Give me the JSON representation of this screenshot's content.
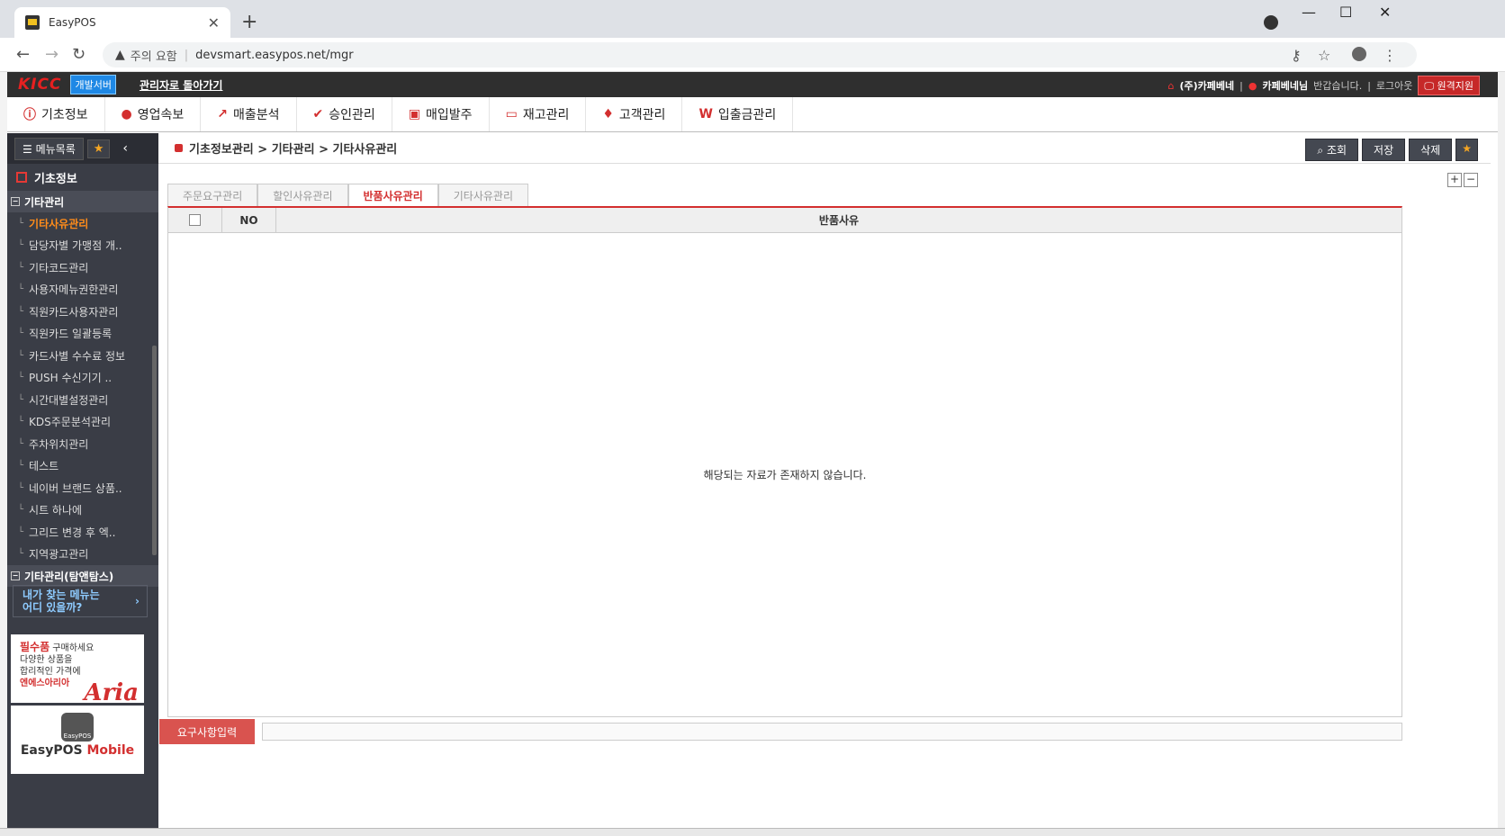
{
  "browser": {
    "tab_title": "EasyPOS",
    "security_label": "주의 요함",
    "url": "devsmart.easypos.net/mgr"
  },
  "header": {
    "logo": "KICC",
    "dev_badge": "개발서버",
    "back_link": "관리자로 돌아가기",
    "store": "(주)카페베네",
    "user": "카페베네님",
    "greeting": "반갑습니다.",
    "logout": "로그아웃",
    "remote": "원격지원"
  },
  "nav": [
    {
      "label": "기초정보",
      "icon": "ⓘ"
    },
    {
      "label": "영업속보",
      "icon": "●"
    },
    {
      "label": "매출분석",
      "icon": "↗"
    },
    {
      "label": "승인관리",
      "icon": "✔"
    },
    {
      "label": "매입발주",
      "icon": "▣"
    },
    {
      "label": "재고관리",
      "icon": "▭"
    },
    {
      "label": "고객관리",
      "icon": "♦"
    },
    {
      "label": "입출금관리",
      "icon": "W"
    }
  ],
  "sidebar": {
    "menu_button": "메뉴목록",
    "section": "기초정보",
    "group1": "기타관리",
    "items": [
      {
        "label": "기타사유관리",
        "active": true
      },
      {
        "label": "담당자별 가맹점 개.."
      },
      {
        "label": "기타코드관리"
      },
      {
        "label": "사용자메뉴권한관리"
      },
      {
        "label": "직원카드사용자관리"
      },
      {
        "label": "직원카드 일괄등록"
      },
      {
        "label": "카드사별 수수료 정보"
      },
      {
        "label": "PUSH 수신기기 .."
      },
      {
        "label": "시간대별설정관리"
      },
      {
        "label": "KDS주문분석관리"
      },
      {
        "label": "주차위치관리"
      },
      {
        "label": "테스트"
      },
      {
        "label": "네이버 브랜드 상품.."
      },
      {
        "label": "시트 하나에"
      },
      {
        "label": "그리드 변경 후 엑.."
      },
      {
        "label": "지역광고관리"
      }
    ],
    "group2": "기타관리(탐앤탐스)",
    "finder_line1": "내가 찾는 메뉴는",
    "finder_line2": "어디 있을까?",
    "ad1": {
      "headline_red": "필수품",
      "headline_rest": " 구매하세요",
      "line2": "다양한 상품을",
      "line3": "합리적인 가격에",
      "brand_red": "엔에스아리아",
      "logo_text": "Aria"
    },
    "ad2": {
      "icon_text": "EasyPOS",
      "name_a": "EasyPOS ",
      "name_b": "Mobile"
    }
  },
  "content": {
    "breadcrumb": "기초정보관리 > 기타관리 > 기타사유관리",
    "actions": {
      "search": "조회",
      "save": "저장",
      "delete": "삭제"
    },
    "tabs": [
      {
        "label": "주문요구관리",
        "active": false
      },
      {
        "label": "할인사유관리",
        "active": false
      },
      {
        "label": "반품사유관리",
        "active": true
      },
      {
        "label": "기타사유관리",
        "active": false
      }
    ],
    "grid": {
      "col_no": "NO",
      "col_reason": "반품사유",
      "empty_message": "해당되는 자료가 존재하지 않습니다."
    },
    "request_label": "요구사항입력"
  },
  "colors": {
    "accent": "#d32f2f",
    "sidebar_bg": "#3a3d46",
    "active_menu": "#ff8c1a"
  }
}
